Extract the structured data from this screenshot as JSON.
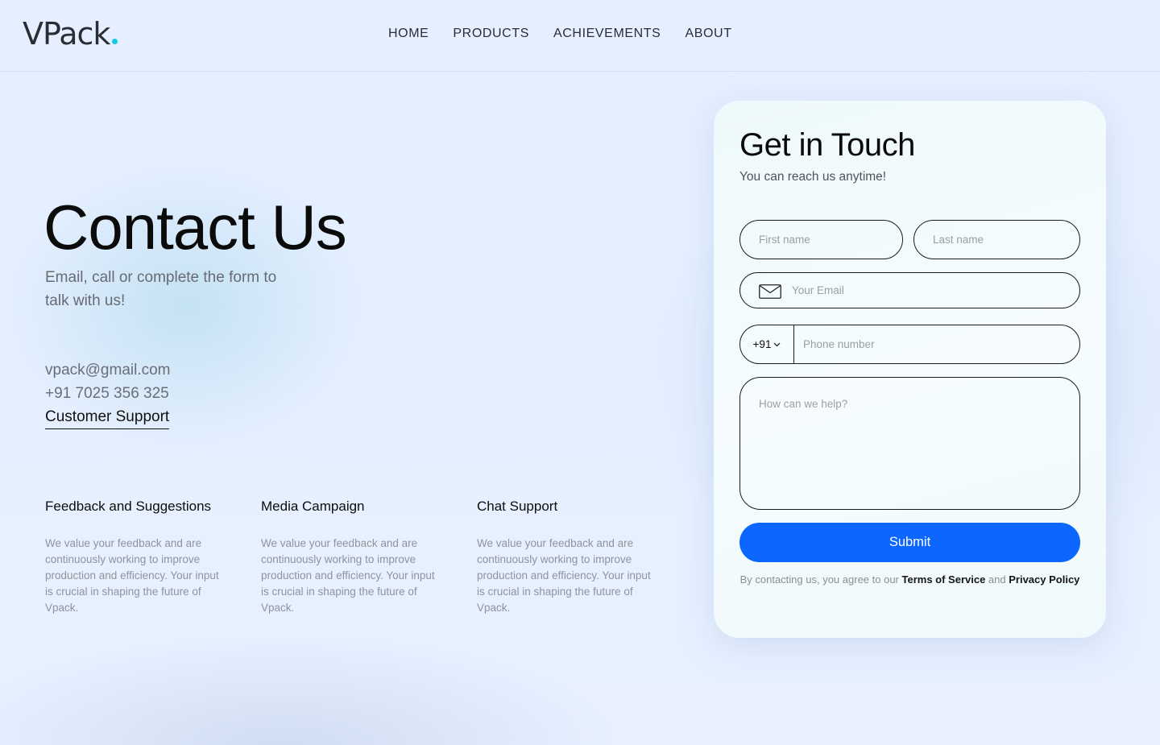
{
  "header": {
    "logo": "VPack",
    "nav": [
      "HOME",
      "PRODUCTS",
      "ACHIEVEMENTS",
      "ABOUT"
    ]
  },
  "hero": {
    "title": "Contact Us",
    "subtitle": "Email, call or complete the form to talk with us!",
    "email": "vpack@gmail.com",
    "phone": "+91 7025 356 325",
    "support_link": "Customer Support"
  },
  "info": [
    {
      "title": "Feedback and Suggestions",
      "text": "We value your feedback and are continuously working to improve production and efficiency. Your input is crucial in shaping the future of Vpack."
    },
    {
      "title": "Media Campaign",
      "text": "We value your feedback and are continuously working to improve production and efficiency. Your input is crucial in shaping the future of Vpack."
    },
    {
      "title": "Chat Support",
      "text": "We value your feedback and are continuously working to improve production and efficiency. Your input is crucial in shaping the future of Vpack."
    }
  ],
  "form": {
    "title": "Get in Touch",
    "subtitle": "You can reach us anytime!",
    "first_name_placeholder": "First name",
    "last_name_placeholder": "Last name",
    "email_placeholder": "Your Email",
    "country_code": "+91",
    "phone_placeholder": "Phone number",
    "message_placeholder": "How can we help?",
    "submit_label": "Submit",
    "terms_prefix": "By contacting us, you agree to our ",
    "terms_link": "Terms of Service",
    "terms_and": " and ",
    "privacy_link": "Privacy Policy"
  },
  "colors": {
    "accent": "#0c66ff",
    "logo_dot": "#14c8e6"
  }
}
